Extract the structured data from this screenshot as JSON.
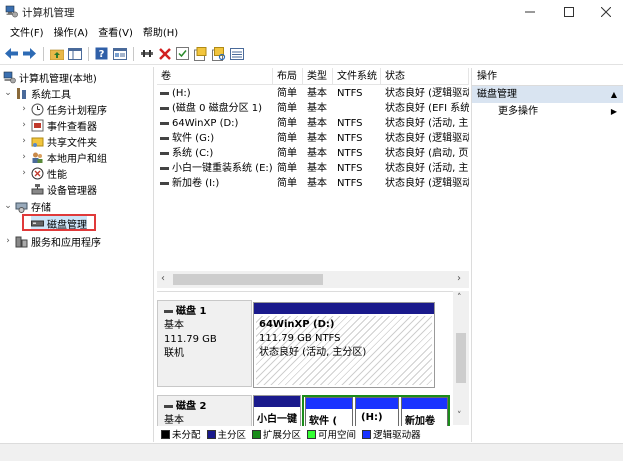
{
  "window": {
    "title": "计算机管理",
    "controls": [
      "minimize-icon",
      "maximize-icon",
      "close-icon"
    ]
  },
  "menu": [
    "文件(F)",
    "操作(A)",
    "查看(V)",
    "帮助(H)"
  ],
  "toolbar": [
    "back-arrow-icon",
    "forward-arrow-icon",
    "folder-up-icon",
    "console-tree-icon",
    "help-icon",
    "properties-icon",
    "connect-icon",
    "delete-icon",
    "check-icon",
    "open-folder-icon",
    "search-folder-icon",
    "view-icon"
  ],
  "tree": {
    "root": "计算机管理(本地)",
    "system_tools": "系统工具",
    "items": [
      "任务计划程序",
      "事件查看器",
      "共享文件夹",
      "本地用户和组",
      "性能",
      "设备管理器"
    ],
    "storage": "存储",
    "disk_management": "磁盘管理",
    "services": "服务和应用程序"
  },
  "volumes": {
    "headers": [
      "卷",
      "布局",
      "类型",
      "文件系统",
      "状态"
    ],
    "rows": [
      [
        "(H:)",
        "简单",
        "基本",
        "NTFS",
        "状态良好 (逻辑驱动器)"
      ],
      [
        "(磁盘 0 磁盘分区 1)",
        "简单",
        "基本",
        "",
        "状态良好 (EFI 系统分区)"
      ],
      [
        "64WinXP  (D:)",
        "简单",
        "基本",
        "NTFS",
        "状态良好 (活动, 主分区)"
      ],
      [
        "软件 (G:)",
        "简单",
        "基本",
        "NTFS",
        "状态良好 (逻辑驱动器)"
      ],
      [
        "系统 (C:)",
        "简单",
        "基本",
        "NTFS",
        "状态良好 (启动, 页面文件)"
      ],
      [
        "小白一键重装系统 (E:)",
        "简单",
        "基本",
        "NTFS",
        "状态良好 (活动, 主分区)"
      ],
      [
        "新加卷 (I:)",
        "简单",
        "基本",
        "NTFS",
        "状态良好 (逻辑驱动器)"
      ]
    ]
  },
  "disks": [
    {
      "name": "磁盘 1",
      "type": "基本",
      "size": "111.79 GB",
      "state": "联机",
      "partitions": [
        {
          "label": "64WinXP   (D:)",
          "size": "111.79 GB NTFS",
          "status": "状态良好 (活动, 主分区)"
        }
      ]
    },
    {
      "name": "磁盘 2",
      "type": "基本",
      "partitions": [
        {
          "label": "小白一键"
        },
        {
          "label": "软件 ("
        },
        {
          "label": "(H:)"
        },
        {
          "label": "新加卷"
        }
      ]
    }
  ],
  "legend": [
    {
      "label": "未分配",
      "color": "#000000"
    },
    {
      "label": "主分区",
      "color": "#1a1a8c"
    },
    {
      "label": "扩展分区",
      "color": "#1a8c1a"
    },
    {
      "label": "可用空间",
      "color": "#33ff33"
    },
    {
      "label": "逻辑驱动器",
      "color": "#1a33ff"
    }
  ],
  "actions": {
    "header": "操作",
    "section": "磁盘管理",
    "more": "更多操作"
  },
  "colors": {
    "primary_partition": "#1a1a8c",
    "logical_drive": "#1a33ff",
    "extended_partition": "#1a8c1a",
    "highlight": "#e03a3a",
    "action_section_bg": "#d9e4f1"
  }
}
